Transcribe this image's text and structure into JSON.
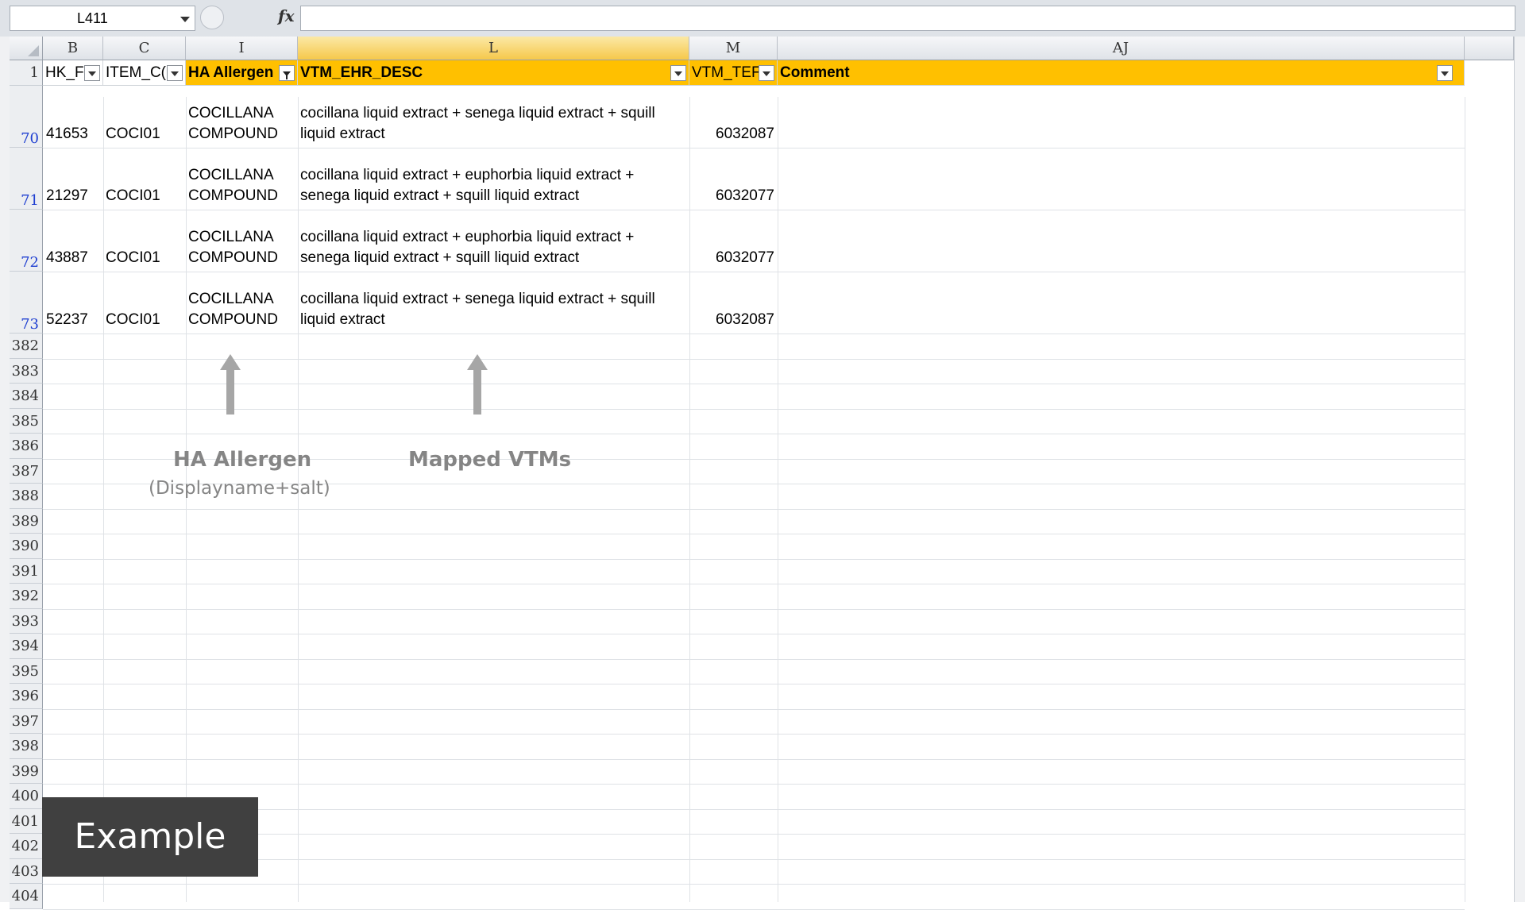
{
  "formula_bar": {
    "name_box": "L411",
    "fx_label": "fx",
    "formula": ""
  },
  "columns": [
    {
      "letter": "B",
      "header": "HK_F"
    },
    {
      "letter": "C",
      "header": "ITEM_C("
    },
    {
      "letter": "I",
      "header": "HA Allergen"
    },
    {
      "letter": "L",
      "header": "VTM_EHR_DESC"
    },
    {
      "letter": "M",
      "header": "VTM_TEF"
    },
    {
      "letter": "AJ",
      "header": "Comment"
    }
  ],
  "header_row_number": "1",
  "data_rows": [
    {
      "row": "70",
      "b": "41653",
      "c": "COCI01",
      "i1": "COCILLANA",
      "i2": "COMPOUND",
      "l1": "cocillana liquid extract + senega liquid extract + squill",
      "l2": "liquid extract",
      "m": "6032087"
    },
    {
      "row": "71",
      "b": "21297",
      "c": "COCI01",
      "i1": "COCILLANA",
      "i2": "COMPOUND",
      "l1": "cocillana liquid extract + euphorbia liquid extract +",
      "l2": "senega liquid extract + squill liquid extract",
      "m": "6032077"
    },
    {
      "row": "72",
      "b": "43887",
      "c": "COCI01",
      "i1": "COCILLANA",
      "i2": "COMPOUND",
      "l1": "cocillana liquid extract + euphorbia liquid extract +",
      "l2": "senega liquid extract + squill liquid extract",
      "m": "6032077"
    },
    {
      "row": "73",
      "b": "52237",
      "c": "COCI01",
      "i1": "COCILLANA",
      "i2": "COMPOUND",
      "l1": "cocillana liquid extract + senega liquid extract + squill",
      "l2": "liquid extract",
      "m": "6032087"
    }
  ],
  "empty_rows": [
    "382",
    "383",
    "384",
    "385",
    "386",
    "387",
    "388",
    "389",
    "390",
    "391",
    "392",
    "393",
    "394",
    "395",
    "396",
    "397",
    "398",
    "399",
    "400",
    "401",
    "402",
    "403",
    "404"
  ],
  "annotations": {
    "allergen_title": "HA Allergen",
    "allergen_sub": "(Displayname+salt)",
    "vtm_title": "Mapped VTMs",
    "example_label": "Example"
  },
  "colors": {
    "header_gold": "#ffc000",
    "filtered_row_number": "#1f3fd1",
    "annotation_gray": "#858585",
    "example_bg": "#404040"
  }
}
